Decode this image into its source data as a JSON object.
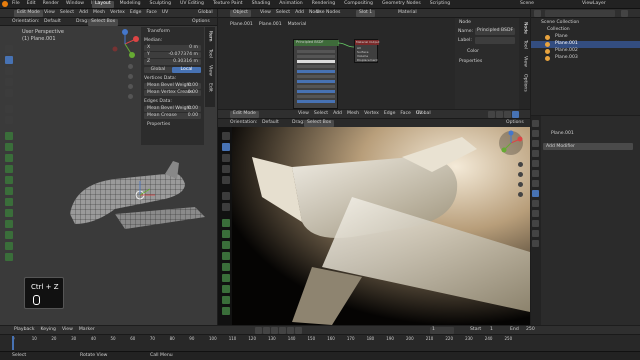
{
  "app": {
    "menu": [
      "File",
      "Edit",
      "Render",
      "Window",
      "Help"
    ],
    "workspaces": [
      "Layout",
      "Modeling",
      "Sculpting",
      "UV Editing",
      "Texture Paint",
      "Shading",
      "Animation",
      "Rendering",
      "Compositing",
      "Geometry Nodes",
      "Scripting"
    ],
    "active_workspace": "Layout",
    "scene": "Scene",
    "view_layer": "ViewLayer"
  },
  "left_viewport": {
    "mode": "Edit Mode",
    "menus": [
      "View",
      "Select",
      "Add",
      "Mesh",
      "Vertex",
      "Edge",
      "Face",
      "UV"
    ],
    "orientation": "Global",
    "transform_orientation_label": "Orientation:",
    "orientation_value": "Default",
    "drag_label": "Drag:",
    "drag_value": "Select Box",
    "options": "Options",
    "title": "User Perspective",
    "subtitle": "(1) Plane.001",
    "key_hint": "Ctrl + Z"
  },
  "n_panel": {
    "header": "Transform",
    "median": "Median:",
    "x_label": "X",
    "x_val": "0 m",
    "y_label": "Y",
    "y_val": "-0.077374 m",
    "z_label": "Z",
    "z_val": "0.30316 m",
    "global": "Global",
    "local": "Local",
    "vertex_data": "Vertices Data:",
    "bevel_weight_label": "Mean Bevel Weight",
    "bevel_weight_val": "0.00",
    "crease_label": "Mean Vertex Crease",
    "crease_val": "0.00",
    "edges_data": "Edges Data:",
    "edge_bevel_label": "Mean Bevel Weight",
    "edge_bevel_val": "0.00",
    "edge_crease_label": "Mean Crease",
    "edge_crease_val": "0.00",
    "properties": "Properties",
    "tabs": [
      "Item",
      "Tool",
      "View",
      "Edit"
    ]
  },
  "shader_editor": {
    "object": "Object",
    "menus": [
      "View",
      "Select",
      "Add",
      "Node"
    ],
    "use_nodes": "Use Nodes",
    "slot": "Slot 1",
    "material": "Material",
    "breadcrumb_obj": "Plane.001",
    "breadcrumb_mesh": "Plane.001",
    "breadcrumb_mat": "Material",
    "node_panel_header": "Node",
    "name_label": "Name:",
    "name_val": "Principled BSDF",
    "label_label": "Label:",
    "color_label": "Color",
    "properties": "Properties",
    "side_tabs": [
      "Node",
      "Tool",
      "View",
      "Options"
    ],
    "bsdf_title": "Principled BSDF",
    "output_title": "Material Output",
    "output_rows": [
      "All",
      "Surface",
      "Volume",
      "Displacement"
    ]
  },
  "right_viewport": {
    "mode": "Edit Mode",
    "menus": [
      "View",
      "Select",
      "Add",
      "Mesh",
      "Vertex",
      "Edge",
      "Face",
      "UV"
    ],
    "orientation": "Global",
    "orientation_label": "Orientation:",
    "orientation_value": "Default",
    "drag_label": "Drag:",
    "drag_value": "Select Box",
    "options": "Options"
  },
  "outliner": {
    "header": "Scene Collection",
    "items": [
      {
        "name": "Collection",
        "indent": 0
      },
      {
        "name": "Plane",
        "indent": 1
      },
      {
        "name": "Plane.001",
        "indent": 1
      },
      {
        "name": "Plane.002",
        "indent": 1
      },
      {
        "name": "Plane.003",
        "indent": 1
      }
    ]
  },
  "properties": {
    "object": "Plane.001",
    "add_modifier": "Add Modifier"
  },
  "timeline": {
    "menus": [
      "Playback",
      "Keying",
      "View",
      "Marker"
    ],
    "current_frame": "1",
    "start_label": "Start",
    "start": "1",
    "end_label": "End",
    "end": "250",
    "ticks": [
      "0",
      "10",
      "20",
      "30",
      "40",
      "50",
      "60",
      "70",
      "80",
      "90",
      "100",
      "110",
      "120",
      "130",
      "140",
      "150",
      "160",
      "170",
      "180",
      "190",
      "200",
      "210",
      "220",
      "230",
      "240",
      "250"
    ]
  },
  "status": {
    "select": "Select",
    "rotate": "Rotate View",
    "call_menu": "Call Menu"
  }
}
